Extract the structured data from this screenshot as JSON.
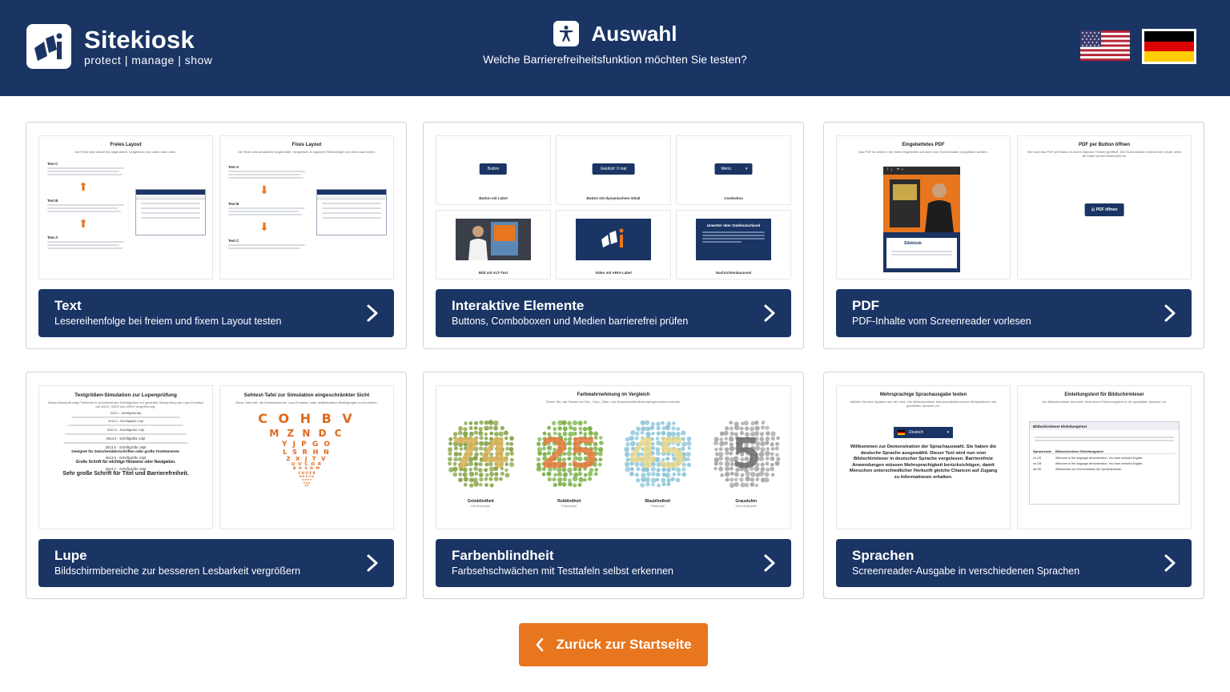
{
  "header": {
    "logo_name": "Sitekiosk",
    "logo_tagline": "protect | manage | show",
    "title": "Auswahl",
    "subtitle": "Welche Barrierefreiheitsfunktion möchten Sie testen?",
    "icons": {
      "logo": "sitekiosk-logo-icon",
      "accessibility": "accessibility-icon",
      "us_flag": "us-flag-icon",
      "de_flag": "german-flag-icon"
    },
    "colors": {
      "header_bg": "#1a3464",
      "accent": "#e8761e"
    }
  },
  "cards": [
    {
      "title": "Text",
      "subtitle": "Lesereihenfolge bei freiem und fixem Layout testen",
      "preview": {
        "left_title": "Freies Layout",
        "left_intro": "Die Texte sind visuell frei angeordnet. Vorgelesen von unten nach oben.",
        "right_title": "Fixes Layout",
        "right_intro": "Die Texte sind strukturiert angeordnet. Vorgelesen in logischer Reihenfolge von oben nach unten.",
        "labels_free": [
          "Text C",
          "Text B",
          "Text A"
        ],
        "labels_fixed": [
          "Text A",
          "Text B",
          "Text C"
        ]
      }
    },
    {
      "title": "Interaktive Elemente",
      "subtitle": "Buttons, Comboboxen und Medien barrierefrei prüfen",
      "preview": {
        "btn1": "Button",
        "lbl1": "Button mit Label",
        "btn2": "Geklickt: 0 mal",
        "lbl2": "Button mit dynamischem Inhalt",
        "btn3": "Menü",
        "lbl3": "Combobox",
        "lbl4": "Bild mit ALT-Text",
        "lbl5": "Video mit ARIA-Label",
        "news_title": "Unwetter über Süddeutschland",
        "lbl6": "Nachrichtenkarussel"
      }
    },
    {
      "title": "PDF",
      "subtitle": "PDF-Inhalte vom Screenreader vorlesen",
      "preview": {
        "left_title": "Eingebettetes PDF",
        "left_intro": "Das PDF ist direkt in die Seite eingebettet und kann vom Screenreader vorgelesen werden.",
        "right_title": "PDF per Button öffnen",
        "right_intro": "Hier wird das PDF per Button in einem eigenen Fenster geöffnet. Der Screenreader erkennt den Inhalt, wenn die Datei korrekt strukturiert ist.",
        "btn": "PDF öffnen"
      }
    },
    {
      "title": "Lupe",
      "subtitle": "Bildschirmbereiche zur besseren Lesbarkeit vergrößern",
      "preview": {
        "left_title": "Textgrößen-Simulation zur Lupenprüfung",
        "left_intro": "Dieser Abschnitt zeigt Fließtexte in verschiedenen Schriftgrößen zur gezielten Überprüfung der Lupe-Funktion bei 200%, 300% und 400% Vergrößerung.",
        "sizes": [
          "2013.1 - Schriftgröße 8pt",
          "2013.2 - Schriftgröße 10pt",
          "2013.3 - Schriftgröße 12pt",
          "2013.4 - Schriftgröße 14pt",
          "2013.5 - Schriftgröße 18pt",
          "2013.6 - Schriftgröße 24pt",
          "2013.7 - Schriftgröße 32pt"
        ],
        "bold_18": "Geeignet für Zwischenüberschriften oder große Textelemente.",
        "bold_24": "Große Schrift für wichtige Hinweise oder Navigation.",
        "bold_32": "Sehr große Schrift für Titel und Barrierefreiheit.",
        "right_title": "Sehtest-Tafel zur Simulation eingeschränkter Sicht",
        "right_intro": "Diese Tafel hilft, die Wirksamkeit der Lupe-Funktion unter realitätsnahen Bedingungen zu beurteilen.",
        "rows": [
          "C O H B V",
          "M Z N D C",
          "Y J P G O",
          "L S R H N",
          "Z X J T V",
          "U V C O R",
          "B H S D M",
          "C H O E R",
          "N E E V H",
          "O H E T",
          "V B D",
          "R B"
        ]
      }
    },
    {
      "title": "Farbenblindheit",
      "subtitle": "Farbsehschwächen mit Testtafeln selbst erkennen",
      "preview": {
        "title": "Farbwahrnehmung im Vergleich",
        "intro": "Sehen Sie, wie Farben bei Rot-, Grün-, Blau- und Graustufenblindheit wahrgenommen werden.",
        "plates": [
          {
            "number": "74",
            "label": "Grünblindheit",
            "sub": "Deuteranopie",
            "c1": "#8aa64b",
            "c2": "#d9b25a"
          },
          {
            "number": "25",
            "label": "Rotblindheit",
            "sub": "Protanopie",
            "c1": "#7fb34d",
            "c2": "#e67a3e"
          },
          {
            "number": "45",
            "label": "Blaublindheit",
            "sub": "Tritanopie",
            "c1": "#8fc6d9",
            "c2": "#e8d88a"
          },
          {
            "number": "5",
            "label": "Graustufen",
            "sub": "Achromatopsie",
            "c1": "#a9a9a9",
            "c2": "#6b6b6b"
          }
        ]
      }
    },
    {
      "title": "Sprachen",
      "subtitle": "Screenreader-Ausgabe in verschiedenen Sprachen",
      "preview": {
        "left_title": "Mehrsprachige Sprachausgabe testen",
        "left_intro": "Wählen Sie eine Sprache aus der Liste. Der Bildschirmleser liest anschließend einen Beispieltext in der gewählten Sprache vor.",
        "select": "Deutsch",
        "welcome": "Willkommen zur Demonstration der Sprachauswahl. Sie haben die deutsche Sprache ausgewählt. Dieser Text wird nun vom Bildschirmleser in deutscher Sprache vorgelesen. Barrierefreie Anwendungen müssen Mehrsprachigkeit berücksichtigen, damit Menschen unterschiedlicher Herkunft gleiche Chancen auf Zugang zu Informationen erhalten.",
        "right_title": "Einleitungstext für Bildschirmleser",
        "right_intro": "Der Bildschirmleser liest beim Start einen Einführungstext in der gewählten Sprache vor.",
        "table_header": "Bildschirmleser Einleitungstext",
        "col1": "Sprachcode",
        "col2": "Bildschirmleser Einleitungstext",
        "rows": [
          {
            "code": "en-US",
            "text": "Welcome to the language demonstration. You have selected English."
          },
          {
            "code": "en-GB",
            "text": "Welcome to the language demonstration. You have selected English."
          },
          {
            "code": "de-DE",
            "text": "Willkommen zur Demonstration der Sprachauswahl."
          }
        ]
      }
    }
  ],
  "back_button": {
    "label": "Zurück zur Startseite"
  }
}
